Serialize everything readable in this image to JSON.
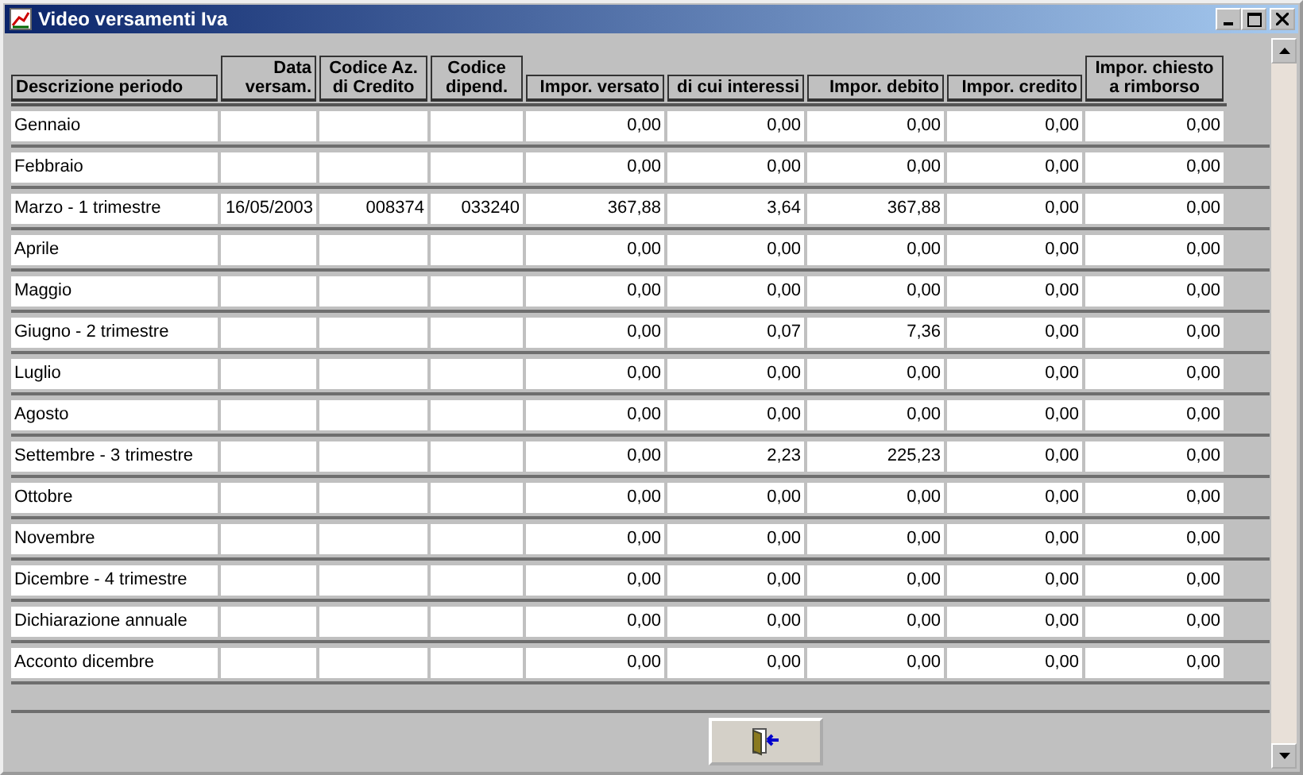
{
  "window": {
    "title": "Video versamenti Iva"
  },
  "table": {
    "columns": [
      "Descrizione periodo",
      "Data versam.",
      "Codice Az. di Credito",
      "Codice dipend.",
      "Impor. versato",
      "di cui interessi",
      "Impor. debito",
      "Impor. credito",
      "Impor. chiesto a rimborso"
    ],
    "rows": [
      {
        "cells": [
          "Gennaio",
          null,
          null,
          null,
          "0,00",
          "0,00",
          "0,00",
          "0,00",
          "0,00"
        ]
      },
      {
        "cells": [
          "Febbraio",
          null,
          null,
          null,
          "0,00",
          "0,00",
          "0,00",
          "0,00",
          "0,00"
        ]
      },
      {
        "cells": [
          "Marzo - 1 trimestre",
          "16/05/2003",
          "008374",
          "033240",
          "367,88",
          "3,64",
          "367,88",
          "0,00",
          "0,00"
        ]
      },
      {
        "cells": [
          "Aprile",
          null,
          null,
          null,
          "0,00",
          "0,00",
          "0,00",
          "0,00",
          "0,00"
        ]
      },
      {
        "cells": [
          "Maggio",
          null,
          null,
          null,
          "0,00",
          "0,00",
          "0,00",
          "0,00",
          "0,00"
        ]
      },
      {
        "cells": [
          "Giugno - 2 trimestre",
          null,
          null,
          null,
          "0,00",
          "0,07",
          "7,36",
          "0,00",
          "0,00"
        ]
      },
      {
        "cells": [
          "Luglio",
          null,
          null,
          null,
          "0,00",
          "0,00",
          "0,00",
          "0,00",
          "0,00"
        ]
      },
      {
        "cells": [
          "Agosto",
          null,
          null,
          null,
          "0,00",
          "0,00",
          "0,00",
          "0,00",
          "0,00"
        ]
      },
      {
        "cells": [
          "Settembre - 3 trimestre",
          null,
          null,
          null,
          "0,00",
          "2,23",
          "225,23",
          "0,00",
          "0,00"
        ]
      },
      {
        "cells": [
          "Ottobre",
          null,
          null,
          null,
          "0,00",
          "0,00",
          "0,00",
          "0,00",
          "0,00"
        ]
      },
      {
        "cells": [
          "Novembre",
          null,
          null,
          null,
          "0,00",
          "0,00",
          "0,00",
          "0,00",
          "0,00"
        ]
      },
      {
        "cells": [
          "Dicembre - 4 trimestre",
          null,
          null,
          null,
          "0,00",
          "0,00",
          "0,00",
          "0,00",
          "0,00"
        ]
      },
      {
        "cells": [
          "Dichiarazione annuale",
          null,
          null,
          null,
          "0,00",
          "0,00",
          "0,00",
          "0,00",
          "0,00"
        ]
      },
      {
        "cells": [
          "Acconto dicembre",
          null,
          null,
          null,
          "0,00",
          "0,00",
          "0,00",
          "0,00",
          "0,00"
        ]
      }
    ]
  }
}
